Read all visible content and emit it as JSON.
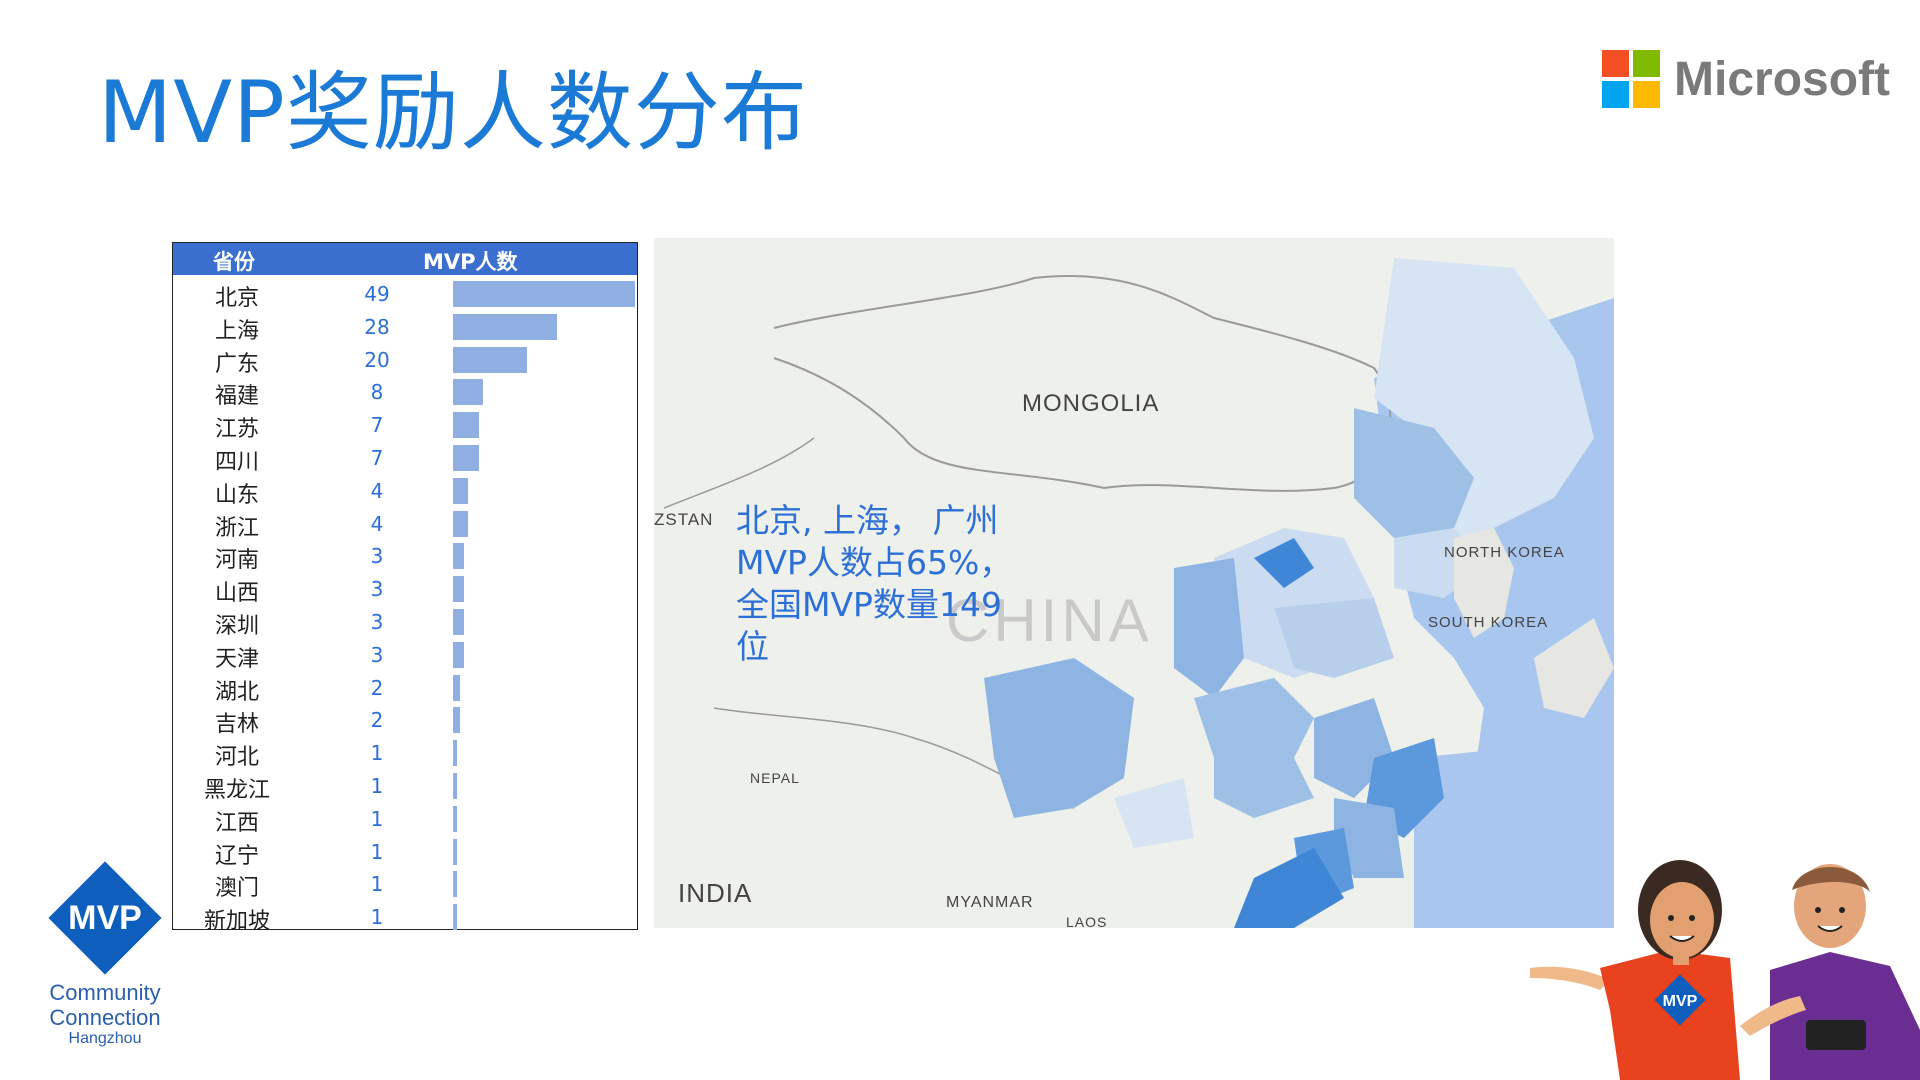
{
  "title": "MVP奖励人数分布",
  "brand": {
    "name": "Microsoft",
    "colors": [
      "#f25022",
      "#7fba00",
      "#00a4ef",
      "#ffb900"
    ]
  },
  "chart_data": {
    "type": "bar",
    "orientation": "horizontal",
    "columns": [
      "省份",
      "MVP人数"
    ],
    "categories": [
      "北京",
      "上海",
      "广东",
      "福建",
      "江苏",
      "四川",
      "山东",
      "浙江",
      "河南",
      "山西",
      "深圳",
      "天津",
      "湖北",
      "吉林",
      "河北",
      "黑龙江",
      "江西",
      "辽宁",
      "澳门",
      "新加坡"
    ],
    "values": [
      49,
      28,
      20,
      8,
      7,
      7,
      4,
      4,
      3,
      3,
      3,
      3,
      2,
      2,
      1,
      1,
      1,
      1,
      1,
      1
    ],
    "bar_color": "#8faee2",
    "header_color": "#3a6fd0"
  },
  "map": {
    "labels": {
      "mongolia": "MONGOLIA",
      "china": "CHINA",
      "north_korea": "NORTH KOREA",
      "south_korea": "SOUTH KOREA",
      "india": "INDIA",
      "myanmar": "MYANMAR",
      "nepal": "NEPAL",
      "kazakhstan_partial": "ZSTAN",
      "laos": "LAOS"
    },
    "note_lines": [
      "北京, 上海， 广州",
      "MVP人数占65%，",
      "全国MVP数量149",
      "位"
    ]
  },
  "mvp_logo": {
    "badge": "MVP",
    "line1": "Community",
    "line2": "Connection",
    "line3": "Hangzhou"
  },
  "mascot_badge": "MVP"
}
